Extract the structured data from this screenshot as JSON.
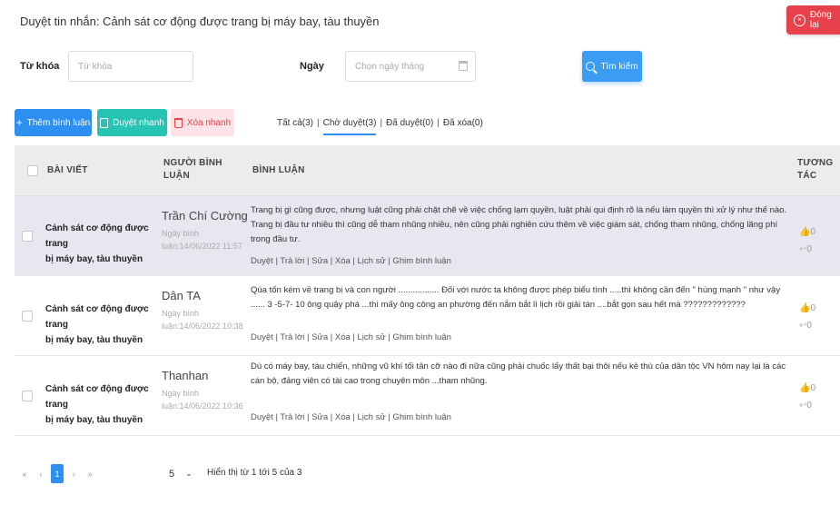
{
  "header": {
    "title": "Duyệt tin nhắn: Cảnh sát cơ động được trang bị máy bay, tàu thuyền",
    "close_label": "Đóng lại"
  },
  "filters": {
    "keyword_label": "Từ khóa",
    "keyword_placeholder": "Từ khóa",
    "date_label": "Ngày",
    "date_placeholder": "Chọn ngày tháng",
    "search_label": "Tìm kiếm"
  },
  "toolbar": {
    "add_label": "Thêm bình luận",
    "approve_label": "Duyệt nhanh",
    "delete_label": "Xóa nhanh"
  },
  "tabs": [
    "Tất cả(3)",
    "Chờ duyệt(3)",
    "Đã duyệt(0)",
    "Đã xóa(0)"
  ],
  "table": {
    "headers": {
      "post": "BÀI VIẾT",
      "author_1": "NGƯỜI BÌNH",
      "author_2": "LUẬN",
      "comment": "BÌNH LUẬN",
      "react_1": "TƯƠNG",
      "react_2": "TÁC"
    },
    "rows": [
      {
        "post_1": "Cảnh sát cơ động được trang",
        "post_2": "bị máy bay, tàu thuyền",
        "author": "Trần Chí Cường",
        "date_1": "Ngày bình",
        "date_2": "luận:14/06/2022 11:57",
        "comment": "Trang bị gì cũng được, nhưng luật cũng phải chặt chẽ về việc chống lạm quyền, luật phải qui định rõ là nếu làm quyền thì xử lý như thế nào. Trang bị đầu tư nhiều thì cũng dễ tham nhũng nhiều, nên cũng phải nghiên cứu thêm về việc giám sát, chống tham nhũng, chống lãng phí trong đầu tư.",
        "actions": "Duyệt | Trả lời | Sửa | Xóa | Lịch sử | Ghim bình luận",
        "likes": "0",
        "replies": "0"
      },
      {
        "post_1": "Cảnh sát cơ động được trang",
        "post_2": "bị máy bay, tàu thuyền",
        "author": "Dân TA",
        "date_1": "Ngày bình",
        "date_2": "luận:14/06/2022 10:38",
        "comment": "Qúa tốn  kém về trang bị và con người ................. Đối với nước ta không được phép biểu tình .....thì không cần đến \" hùng mạnh \" như vậy ...... 3 -5-7- 10 ông quậy phá ...thì mấy ông công an phường đến nắm bắt lì lịch rồi giải tán ....bắt gọn sau hết mà ?????????????",
        "actions": "Duyệt | Trả lời | Sửa | Xóa | Lịch sử | Ghim bình luận",
        "likes": "0",
        "replies": "0"
      },
      {
        "post_1": "Cảnh sát cơ động được trang",
        "post_2": "bị máy bay, tàu thuyền",
        "author": "Thanhan",
        "date_1": "Ngày bình",
        "date_2": "luận:14/06/2022 10:36",
        "comment": "Dù có máy bay, tàu chiến, những vũ khí tối tân cỡ nào đi nữa cũng phải chuốc lấy thất bại thôi nếu kẻ thù của dân tộc VN hôm nay lại là các cán bộ, đảng viên có tài cao trong chuyên môn ...tham nhũng.",
        "actions": "Duyệt | Trả lời | Sửa | Xóa | Lịch sử | Ghim bình luận",
        "likes": "0",
        "replies": "0"
      }
    ]
  },
  "pagination": {
    "first": "«",
    "prev": "‹",
    "page": "1",
    "next": "›",
    "last": "»",
    "per_page": "5",
    "info": "Hiển thị từ 1 tới 5 của 3"
  }
}
